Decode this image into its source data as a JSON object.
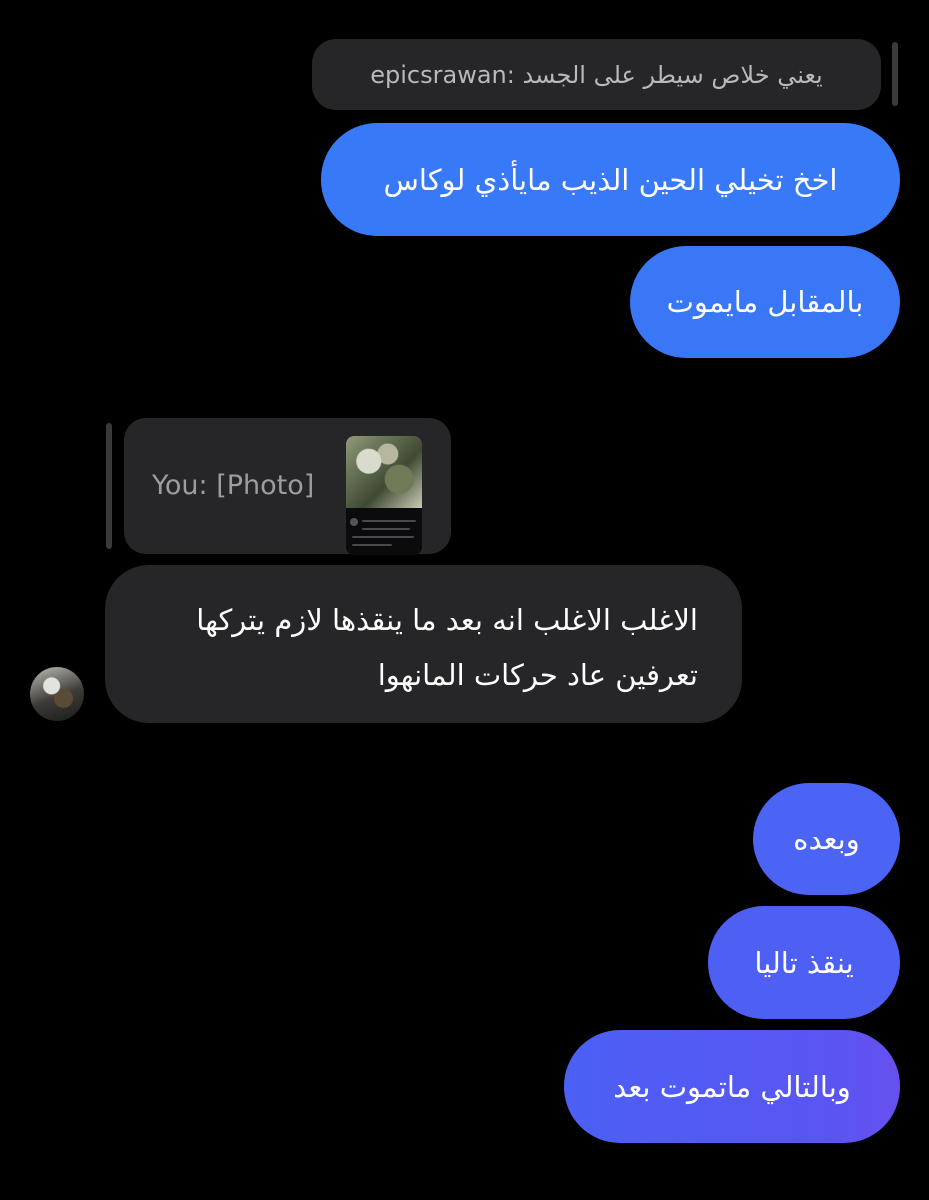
{
  "messages": {
    "reply_quote": {
      "sender": "epicsrawan:",
      "text": "يعني خلاص سيطر على الجسد"
    },
    "sent_1": "اخخ تخيلي الحين الذيب مايأذي لوكاس",
    "sent_2": "بالمقابل مايموت",
    "photo_quote": {
      "label": "You: [Photo]"
    },
    "received": {
      "line_1": "الاغلب الاغلب انه بعد ما ينقذها لازم يتركها",
      "line_2": "تعرفين عاد حركات المانهوا"
    },
    "sent_3": "وبعده",
    "sent_4": "ينقذ تاليا",
    "sent_5": "وبالتالي ماتموت بعد"
  },
  "colors": {
    "background": "#000000",
    "sent_bubble_top": "#3a7af7",
    "sent_bubble_bottom": "#5a52f0",
    "received_bubble": "#262628",
    "quote_bg": "#262628"
  }
}
